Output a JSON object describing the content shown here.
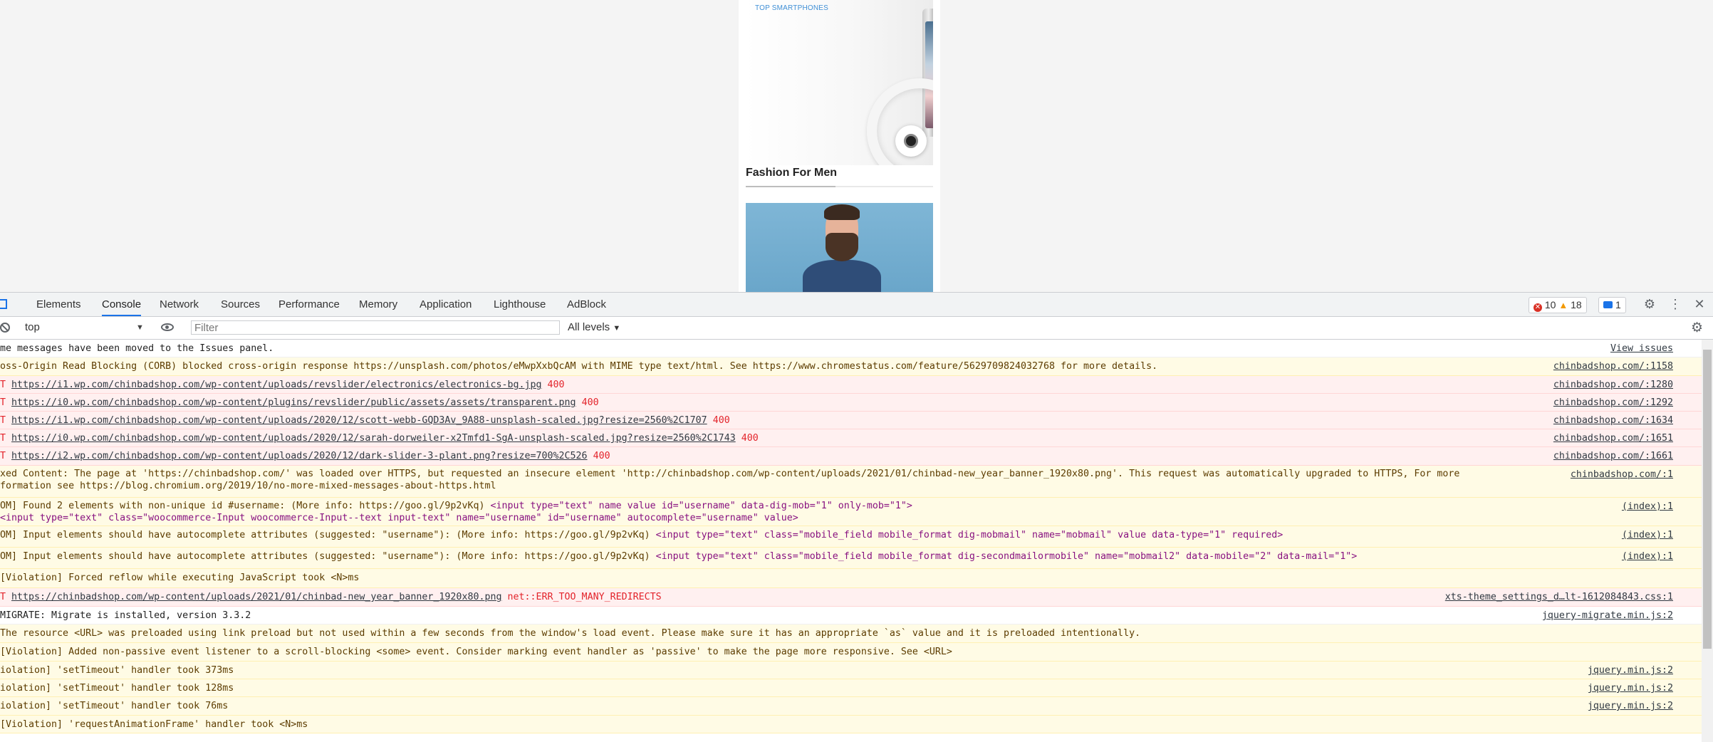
{
  "page": {
    "banner_label": "TOP SMARTPHONES",
    "section_title": "Fashion For Men"
  },
  "devtools": {
    "tabs": [
      "Elements",
      "Console",
      "Network",
      "Sources",
      "Performance",
      "Memory",
      "Application",
      "Lighthouse",
      "AdBlock"
    ],
    "active_tab": "Console",
    "error_count": "10",
    "warning_count": "18",
    "issues_count": "1",
    "toolbar": {
      "context": "top",
      "filter_placeholder": "Filter",
      "levels": "All levels"
    },
    "icons": [
      "inspect-icon",
      "clear-console-icon",
      "eye-icon",
      "gear-icon",
      "kebab-menu-icon",
      "close-icon",
      "caret-down-icon"
    ]
  },
  "console": {
    "rows": [
      {
        "type": "info",
        "text": "me messages have been moved to the Issues panel.",
        "source": "View issues"
      },
      {
        "type": "warn",
        "text": "oss-Origin Read Blocking (CORB) blocked cross-origin response https://unsplash.com/photos/eMwpXxbQcAM with MIME type text/html. See https://www.chromestatus.com/feature/5629709824032768 for more details.",
        "source": "chinbadshop.com/:1158"
      },
      {
        "type": "err",
        "text": "https://i1.wp.com/chinbadshop.com/wp-content/uploads/revslider/electronics/electronics-bg.jpg",
        "status": "400",
        "source": "chinbadshop.com/:1280"
      },
      {
        "type": "err",
        "text": "https://i0.wp.com/chinbadshop.com/wp-content/plugins/revslider/public/assets/assets/transparent.png",
        "status": "400",
        "source": "chinbadshop.com/:1292"
      },
      {
        "type": "err",
        "text": "https://i1.wp.com/chinbadshop.com/wp-content/uploads/2020/12/scott-webb-GQD3Av_9A88-unsplash-scaled.jpg?resize=2560%2C1707",
        "status": "400",
        "source": "chinbadshop.com/:1634"
      },
      {
        "type": "err",
        "text": "https://i0.wp.com/chinbadshop.com/wp-content/uploads/2020/12/sarah-dorweiler-x2Tmfd1-SgA-unsplash-scaled.jpg?resize=2560%2C1743",
        "status": "400",
        "source": "chinbadshop.com/:1651"
      },
      {
        "type": "err",
        "text": "https://i2.wp.com/chinbadshop.com/wp-content/uploads/2020/12/dark-slider-3-plant.png?resize=700%2C526",
        "status": "400",
        "source": "chinbadshop.com/:1661"
      },
      {
        "type": "warn",
        "text": "xed Content: The page at 'https://chinbadshop.com/' was loaded over HTTPS, but requested an insecure element 'http://chinbadshop.com/wp-content/uploads/2021/01/chinbad-new_year_banner_1920x80.png'. This request was automatically upgraded to HTTPS, For more",
        "text2": "formation see https://blog.chromium.org/2019/10/no-more-mixed-messages-about-https.html",
        "source": "chinbadshop.com/:1"
      },
      {
        "type": "warn",
        "text": "OM] Found 2 elements with non-unique id #username: (More info: https://goo.gl/9p2vKq)",
        "html": "<input type=\"text\" name value id=\"username\" data-dig-mob=\"1\" only-mob=\"1\">",
        "text2": "<input type=\"text\" class=\"woocommerce-Input woocommerce-Input--text input-text\" name=\"username\" id=\"username\" autocomplete=\"username\" value>",
        "source": "(index):1"
      },
      {
        "type": "warn",
        "text": "OM] Input elements should have autocomplete attributes (suggested: \"username\"): (More info: https://goo.gl/9p2vKq)",
        "html": "<input type=\"text\" class=\"mobile_field mobile_format dig-mobmail\" name=\"mobmail\" value data-type=\"1\" required>",
        "source": "(index):1"
      },
      {
        "type": "warn",
        "text": "OM] Input elements should have autocomplete attributes (suggested: \"username\"): (More info: https://goo.gl/9p2vKq)",
        "html": "<input type=\"text\" class=\"mobile_field mobile_format dig-secondmailormobile\" name=\"mobmail2\" data-mobile=\"2\" data-mail=\"1\">",
        "source": "(index):1"
      },
      {
        "type": "warn",
        "text": "[Violation] Forced reflow while executing JavaScript took <N>ms",
        "source": ""
      },
      {
        "type": "err",
        "text": "https://chinbadshop.com/wp-content/uploads/2021/01/chinbad-new_year_banner_1920x80.png",
        "status": "net::ERR_TOO_MANY_REDIRECTS",
        "source": "xts-theme_settings_d…lt-1612084843.css:1"
      },
      {
        "type": "info",
        "text": "MIGRATE: Migrate is installed, version 3.3.2",
        "source": "jquery-migrate.min.js:2"
      },
      {
        "type": "warn",
        "text": "The resource <URL> was preloaded using link preload but not used within a few seconds from the window's load event. Please make sure it has an appropriate `as` value and it is preloaded intentionally.",
        "source": ""
      },
      {
        "type": "warn",
        "text": "[Violation] Added non-passive event listener to a scroll-blocking <some> event. Consider marking event handler as 'passive' to make the page more responsive. See <URL>",
        "source": ""
      },
      {
        "type": "warn",
        "text": "iolation] 'setTimeout' handler took 373ms",
        "source": "jquery.min.js:2"
      },
      {
        "type": "warn",
        "text": "iolation] 'setTimeout' handler took 128ms",
        "source": "jquery.min.js:2"
      },
      {
        "type": "warn",
        "text": "iolation] 'setTimeout' handler took 76ms",
        "source": "jquery.min.js:2"
      },
      {
        "type": "warn",
        "text": "[Violation] 'requestAnimationFrame' handler took <N>ms",
        "source": ""
      }
    ]
  }
}
